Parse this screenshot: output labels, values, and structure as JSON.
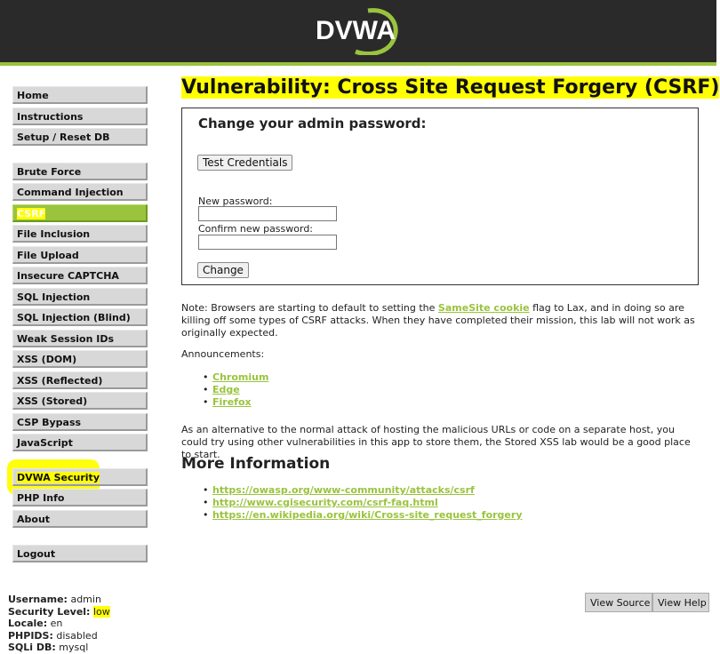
{
  "logo_text": "DVWA",
  "colors": {
    "header_bg": "#2a2a2a",
    "accent": "#9ac33e",
    "highlight": "#ffff00"
  },
  "menu": {
    "group1": [
      "Home",
      "Instructions",
      "Setup / Reset DB"
    ],
    "group2": [
      "Brute Force",
      "Command Injection",
      "CSRF",
      "File Inclusion",
      "File Upload",
      "Insecure CAPTCHA",
      "SQL Injection",
      "SQL Injection (Blind)",
      "Weak Session IDs",
      "XSS (DOM)",
      "XSS (Reflected)",
      "XSS (Stored)",
      "CSP Bypass",
      "JavaScript"
    ],
    "group3": [
      "DVWA Security",
      "PHP Info",
      "About"
    ],
    "group4": [
      "Logout"
    ],
    "selected": "CSRF"
  },
  "main": {
    "title": "Vulnerability: Cross Site Request Forgery (CSRF)",
    "box_heading": "Change your admin password:",
    "test_button": "Test Credentials",
    "new_password_label": "New password:",
    "confirm_password_label": "Confirm new password:",
    "change_button": "Change",
    "note_pre": "Note: Browsers are starting to default to setting the ",
    "note_link": "SameSite cookie",
    "note_post": " flag to Lax, and in doing so are killing off some types of CSRF attacks. When they have completed their mission, this lab will not work as originally expected.",
    "announcements_label": "Announcements:",
    "announcements": [
      "Chromium",
      "Edge",
      "Firefox"
    ],
    "alt_text": "As an alternative to the normal attack of hosting the malicious URLs or code on a separate host, you could try using other vulnerabilities in this app to store them, the Stored XSS lab would be a good place to start.",
    "more_info_heading": "More Information",
    "more_info_links": [
      "https://owasp.org/www-community/attacks/csrf",
      "http://www.cgisecurity.com/csrf-faq.html",
      "https://en.wikipedia.org/wiki/Cross-site_request_forgery"
    ]
  },
  "view_buttons": {
    "source": "View Source",
    "help": "View Help"
  },
  "footer": {
    "username_label": "Username:",
    "username": "admin",
    "security_label": "Security Level:",
    "security": "low",
    "locale_label": "Locale:",
    "locale": "en",
    "phpids_label": "PHPIDS:",
    "phpids": "disabled",
    "sqli_label": "SQLi DB:",
    "sqli": "mysql"
  }
}
